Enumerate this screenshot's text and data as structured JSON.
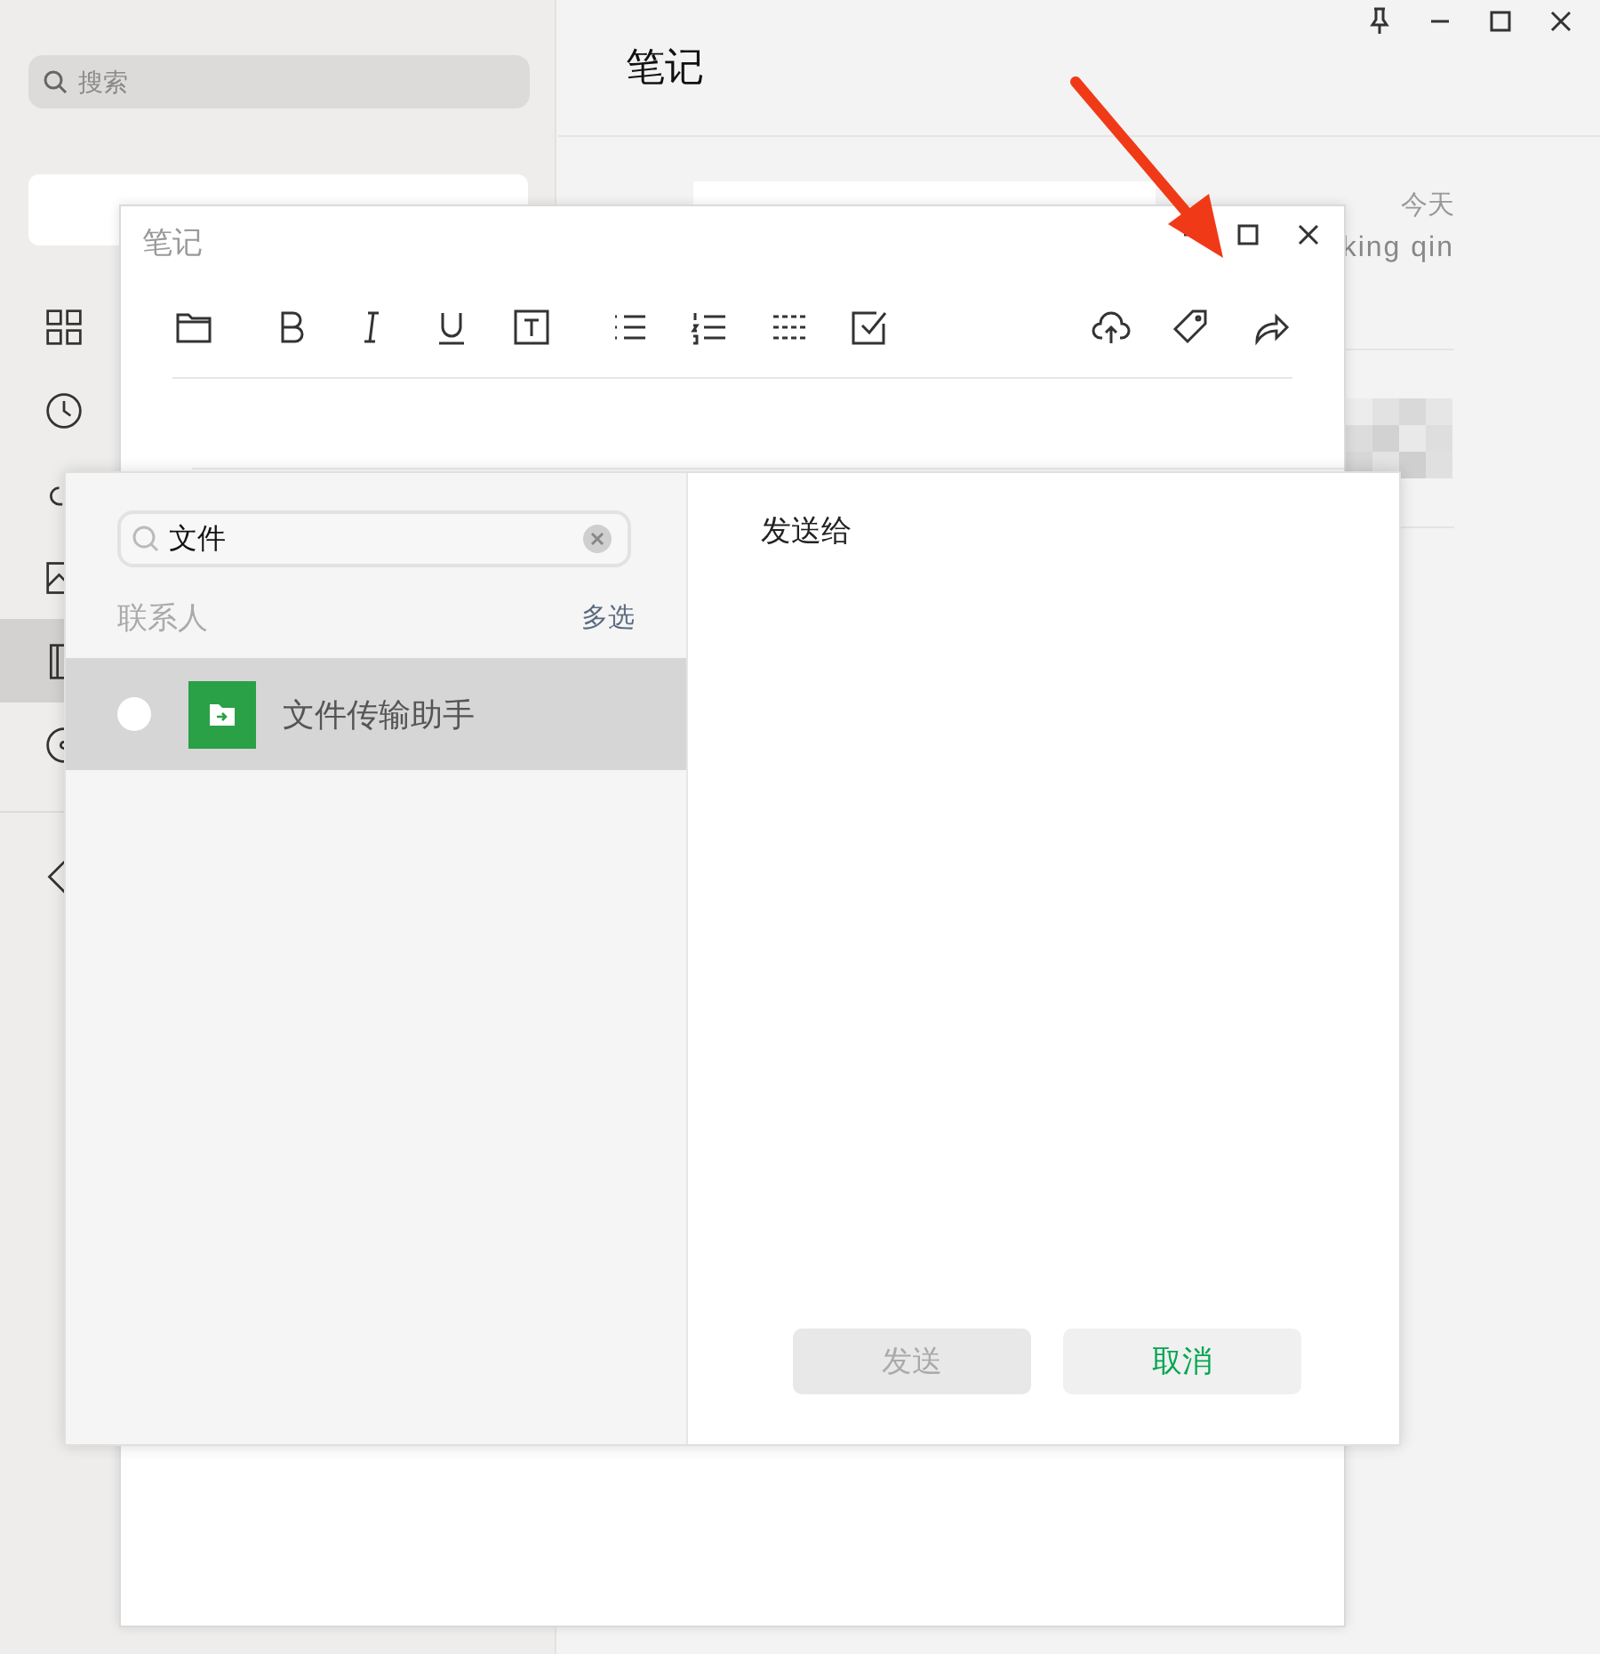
{
  "sidebar": {
    "search": {
      "placeholder": "搜索"
    },
    "nav_items": [
      {
        "selected": false
      },
      {
        "selected": false
      },
      {
        "selected": false
      },
      {
        "selected": false
      },
      {
        "selected": true
      },
      {
        "selected": false
      },
      {
        "selected": false
      }
    ]
  },
  "header": {
    "title": "笔记"
  },
  "note_list": [
    {
      "date": "今天",
      "author": "king qin"
    }
  ],
  "note_window": {
    "title": "笔记"
  },
  "share_dialog": {
    "search": {
      "value": "文件"
    },
    "section_label": "联系人",
    "multi_select": "多选",
    "contacts": [
      {
        "name": "文件传输助手",
        "selected": true,
        "checked": false
      }
    ],
    "send_to_label": "发送给",
    "buttons": [
      {
        "label": "发送",
        "kind": "primary",
        "disabled": true
      },
      {
        "label": "取消",
        "kind": "cancel",
        "disabled": false
      }
    ]
  }
}
